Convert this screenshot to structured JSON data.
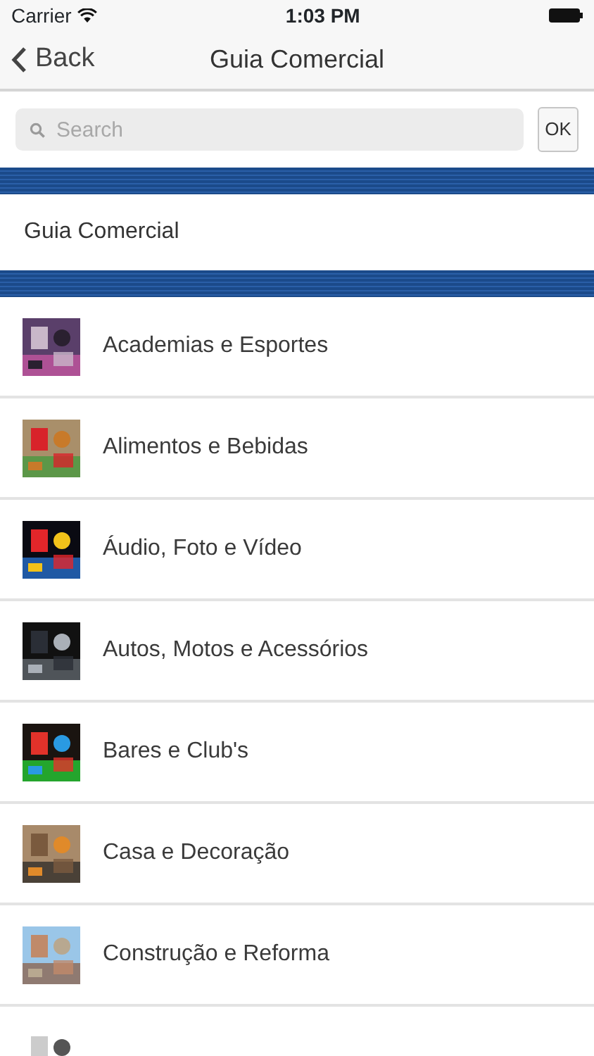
{
  "status_bar": {
    "carrier": "Carrier",
    "time": "1:03 PM"
  },
  "nav_bar": {
    "back": "Back",
    "title": "Guia Comercial"
  },
  "search": {
    "placeholder": "Search",
    "button": "OK"
  },
  "section_title": "Guia Comercial",
  "categories": [
    {
      "label": "Academias e Esportes"
    },
    {
      "label": "Alimentos e Bebidas"
    },
    {
      "label": "Áudio, Foto e Vídeo"
    },
    {
      "label": "Autos, Motos e Acessórios"
    },
    {
      "label": "Bares e Club's"
    },
    {
      "label": "Casa e Decoração"
    },
    {
      "label": "Construção e Reforma"
    },
    {
      "kind": "picture"
    }
  ]
}
